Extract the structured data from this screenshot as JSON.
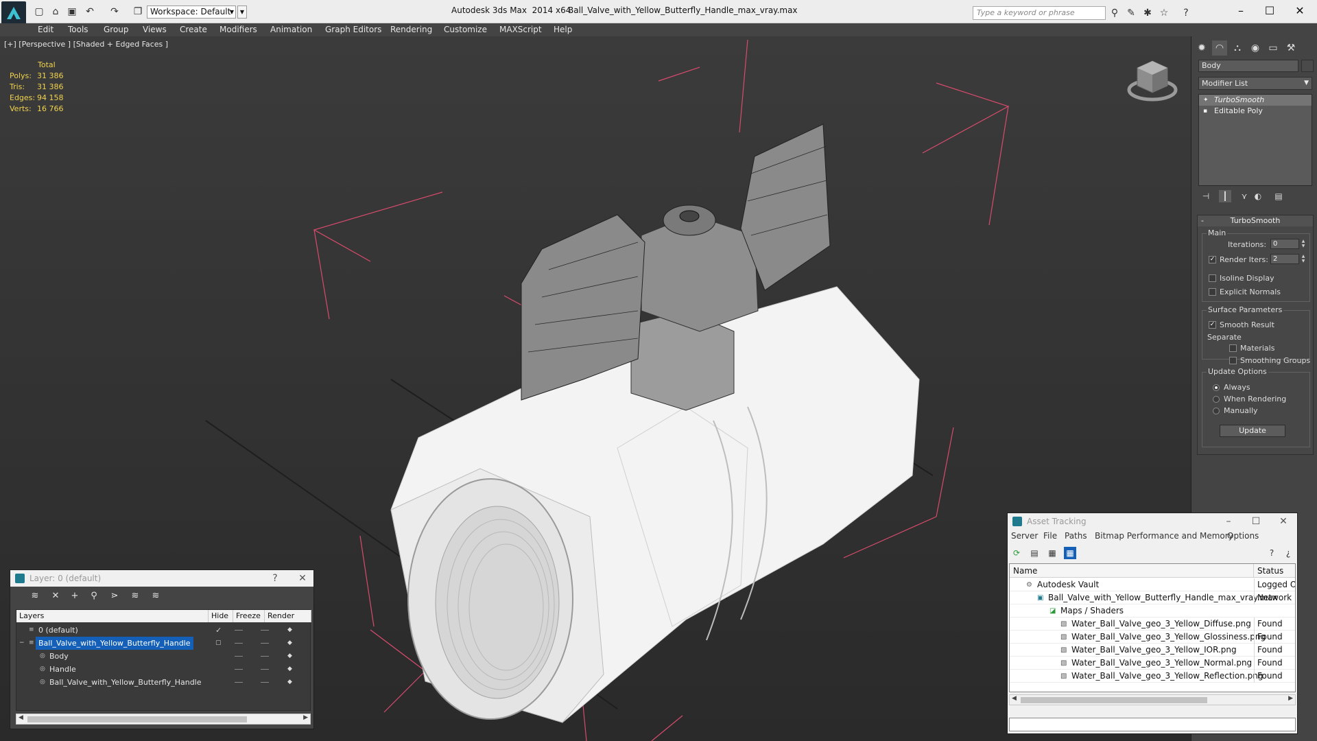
{
  "titlebar": {
    "workspace": "Workspace: Default",
    "app_title": "Autodesk 3ds Max  2014 x64",
    "file_name": "Ball_Valve_with_Yellow_Butterfly_Handle_max_vray.max",
    "search_placeholder": "Type a keyword or phrase"
  },
  "menu": [
    "Edit",
    "Tools",
    "Group",
    "Views",
    "Create",
    "Modifiers",
    "Animation",
    "Graph Editors",
    "Rendering",
    "Customize",
    "MAXScript",
    "Help"
  ],
  "viewport": {
    "label": "[+] [Perspective ] [Shaded + Edged Faces ]",
    "stats": {
      "header": "Total",
      "rows": [
        {
          "label": "Polys:",
          "value": "31 386"
        },
        {
          "label": "Tris:",
          "value": "31 386"
        },
        {
          "label": "Edges:",
          "value": "94 158"
        },
        {
          "label": "Verts:",
          "value": "16 766"
        }
      ]
    }
  },
  "command_panel": {
    "object_name": "Body",
    "modifier_list": "Modifier List",
    "stack": [
      "TurboSmooth",
      "Editable Poly"
    ],
    "rollout_title": "TurboSmooth",
    "main_group": "Main",
    "iterations_label": "Iterations:",
    "iterations_value": "0",
    "render_iters_label": "Render Iters:",
    "render_iters_value": "2",
    "isoline_display": "Isoline Display",
    "explicit_normals": "Explicit Normals",
    "surface_params": "Surface Parameters",
    "smooth_result": "Smooth Result",
    "separate": "Separate",
    "materials": "Materials",
    "smoothing_groups": "Smoothing Groups",
    "update_options": "Update Options",
    "always": "Always",
    "when_rendering": "When Rendering",
    "manually": "Manually",
    "update_button": "Update"
  },
  "layer_window": {
    "title": "Layer: 0 (default)",
    "help": "?",
    "close": "✕",
    "columns": [
      "Layers",
      "Hide",
      "Freeze",
      "Render"
    ],
    "rows": [
      {
        "name": "0 (default)"
      },
      {
        "name": "Ball_Valve_with_Yellow_Butterfly_Handle"
      },
      {
        "name": "Body"
      },
      {
        "name": "Handle"
      },
      {
        "name": "Ball_Valve_with_Yellow_Butterfly_Handle"
      }
    ]
  },
  "asset_window": {
    "title": "Asset Tracking",
    "menu": [
      "Server",
      "File",
      "Paths",
      "Bitmap Performance and Memory",
      "Options"
    ],
    "columns": [
      "Name",
      "Status"
    ],
    "rows": [
      {
        "name": "Autodesk Vault",
        "status": "Logged Out"
      },
      {
        "name": "Ball_Valve_with_Yellow_Butterfly_Handle_max_vray.max",
        "status": "Network Path"
      },
      {
        "name": "Maps / Shaders",
        "status": ""
      },
      {
        "name": "Water_Ball_Valve_geo_3_Yellow_Diffuse.png",
        "status": "Found"
      },
      {
        "name": "Water_Ball_Valve_geo_3_Yellow_Glossiness.png",
        "status": "Found"
      },
      {
        "name": "Water_Ball_Valve_geo_3_Yellow_IOR.png",
        "status": "Found"
      },
      {
        "name": "Water_Ball_Valve_geo_3_Yellow_Normal.png",
        "status": "Found"
      },
      {
        "name": "Water_Ball_Valve_geo_3_Yellow_Reflection.png",
        "status": "Found"
      }
    ]
  },
  "colors": {
    "stats_text": "#f2d34d",
    "selection": "#1460b8",
    "bounding_box": "#d94b6e"
  }
}
